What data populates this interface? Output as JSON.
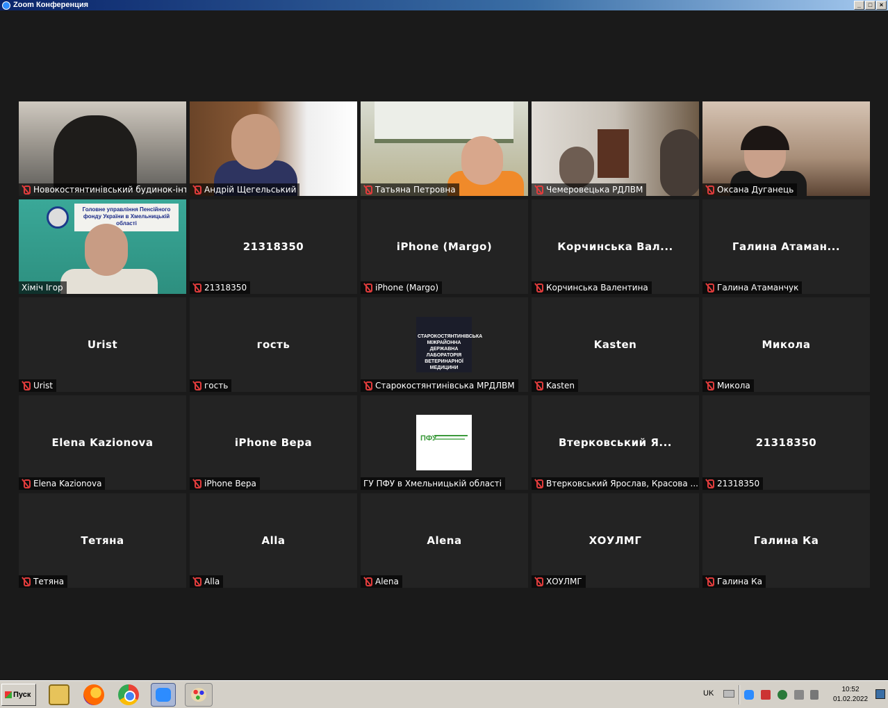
{
  "window": {
    "title": "Zoom Конференция",
    "controls": [
      "_",
      "□",
      "×"
    ]
  },
  "tiles": [
    {
      "display_name": "",
      "label": "Новокостянтинівський будинок-інт...",
      "muted": true,
      "video": true
    },
    {
      "display_name": "",
      "label": "Андрій Щегельський",
      "muted": true,
      "video": true
    },
    {
      "display_name": "",
      "label": "Татьяна Петровна",
      "muted": true,
      "video": true
    },
    {
      "display_name": "",
      "label": "Чемеровецька РДЛВМ",
      "muted": true,
      "video": true
    },
    {
      "display_name": "",
      "label": "Оксана Дуганець",
      "muted": true,
      "video": true
    },
    {
      "display_name": "",
      "label": "Хіміч Ігор",
      "muted": false,
      "video": true,
      "active_speaker": true
    },
    {
      "display_name": "21318350",
      "label": "21318350",
      "muted": true
    },
    {
      "display_name": "iPhone (Margo)",
      "label": "iPhone (Margo)",
      "muted": true
    },
    {
      "display_name": "Корчинська  Вал...",
      "label": "Корчинська Валентина",
      "muted": true
    },
    {
      "display_name": "Галина  Атаман...",
      "label": "Галина Атаманчук",
      "muted": true
    },
    {
      "display_name": "Urist",
      "label": "Urist",
      "muted": true
    },
    {
      "display_name": "гость",
      "label": "гость",
      "muted": true
    },
    {
      "display_name": "",
      "label": "Старокостянтинівська МРДЛВМ",
      "muted": true,
      "thumbnail": "plaque"
    },
    {
      "display_name": "Kasten",
      "label": "Kasten",
      "muted": true
    },
    {
      "display_name": "Микола",
      "label": "Микола",
      "muted": true
    },
    {
      "display_name": "Elena Kazionova",
      "label": "Elena Kazionova",
      "muted": true
    },
    {
      "display_name": "iPhone Вера",
      "label": "iPhone Вера",
      "muted": true
    },
    {
      "display_name": "",
      "label": "ГУ ПФУ в Хмельницькій області",
      "muted": false,
      "thumbnail": "pfu"
    },
    {
      "display_name": "Втерковський  Я...",
      "label": "Втерковський Ярослав, Красова ...",
      "muted": true
    },
    {
      "display_name": "21318350",
      "label": "21318350",
      "muted": true
    },
    {
      "display_name": "Тетяна",
      "label": "Тетяна",
      "muted": true
    },
    {
      "display_name": "Alla",
      "label": "Alla",
      "muted": true
    },
    {
      "display_name": "Alena",
      "label": "Alena",
      "muted": true
    },
    {
      "display_name": "ХОУЛМГ",
      "label": "ХОУЛМГ",
      "muted": true
    },
    {
      "display_name": "Галина Ка",
      "label": "Галина Ка",
      "muted": true
    }
  ],
  "video_text": {
    "sign": "Головне управління Пенсійного фонду України в Хмельницькій області",
    "plaque": "СТАРОКОСТЯНТИНІВСЬКА МІЖРАЙОННА ДЕРЖАВНА ЛАБОРАТОРІЯ ВЕТЕРИНАРНОЇ МЕДИЦИНИ",
    "pfu_logo": "ПФУ"
  },
  "taskbar": {
    "start_label": "Пуск",
    "language": "UK",
    "time": "10:52",
    "date": "01.02.2022",
    "pinned": [
      "explorer-icon",
      "firefox-icon",
      "chrome-icon",
      "zoom-icon",
      "paint-icon"
    ]
  },
  "colors": {
    "background": "#1a1a1a",
    "tile": "#232323",
    "active_speaker_border": "#f5f57a",
    "muted_icon": "#e03c3c"
  }
}
